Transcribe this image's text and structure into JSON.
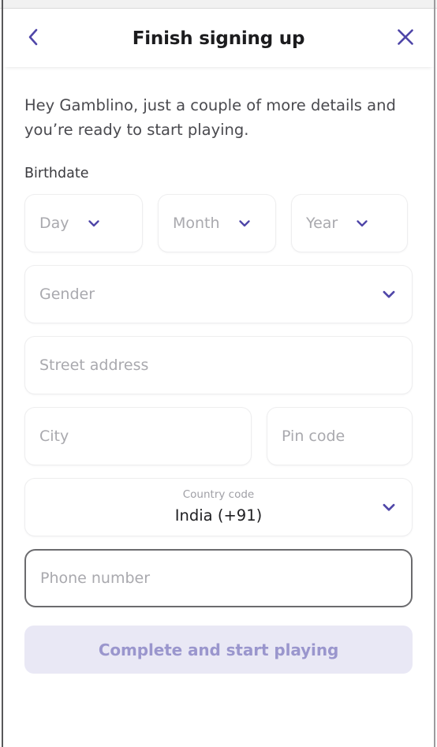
{
  "window": {
    "accent_color": "#4f46a8",
    "background": "#ffffff"
  },
  "header": {
    "title": "Finish signing up",
    "back_icon": "chevron-left-icon",
    "close_icon": "close-icon"
  },
  "main": {
    "greeting": "Hey Gamblino, just a couple of more details and you’re ready to start playing.",
    "birthdate_label": "Birthdate",
    "birthdate": [
      {
        "name": "day",
        "placeholder": "Day",
        "value": "",
        "icon": "chevron-down-icon"
      },
      {
        "name": "month",
        "placeholder": "Month",
        "value": "",
        "icon": "chevron-down-icon"
      },
      {
        "name": "year",
        "placeholder": "Year",
        "value": "",
        "icon": "chevron-down-icon"
      }
    ],
    "gender": {
      "placeholder": "Gender",
      "value": "",
      "icon": "chevron-down-icon"
    },
    "street_address": {
      "placeholder": "Street address",
      "value": ""
    },
    "city": {
      "placeholder": "City",
      "value": ""
    },
    "pin_code": {
      "placeholder": "Pin code",
      "value": ""
    },
    "country_code": {
      "label": "Country code",
      "value": "India (+91)",
      "icon": "chevron-down-icon"
    },
    "phone_number": {
      "placeholder": "Phone number",
      "value": "",
      "focused": true
    },
    "submit": {
      "label": "Complete and start playing",
      "enabled": false,
      "background": "#e9e8f5",
      "text_color": "#9a96cd"
    }
  }
}
